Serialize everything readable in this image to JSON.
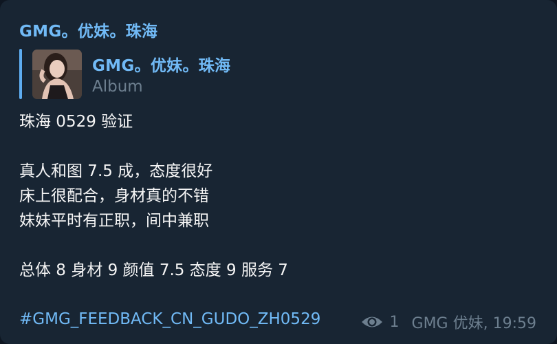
{
  "message": {
    "author": "GMG。优妹。珠海",
    "reply": {
      "title": "GMG。优妹。珠海",
      "subtitle": "Album",
      "thumbnail_icon": "photo-thumbnail"
    },
    "lines": [
      "珠海 0529 验证",
      "",
      "真人和图 7.5 成，态度很好",
      "床上很配合，身材真的不错",
      "妹妹平时有正职，间中兼职",
      "",
      "总体 8 身材 9 颜值 7.5 态度 9 服务 7",
      ""
    ],
    "hashtag": "#GMG_FEEDBACK_CN_GUDO_ZH0529",
    "views": "1",
    "signature_time": "GMG 优妹, 19:59"
  },
  "colors": {
    "background": "#0e1621",
    "bubble": "#182533",
    "accent": "#71baf6",
    "text": "#f5f5f5",
    "muted": "#6d7f8f"
  }
}
